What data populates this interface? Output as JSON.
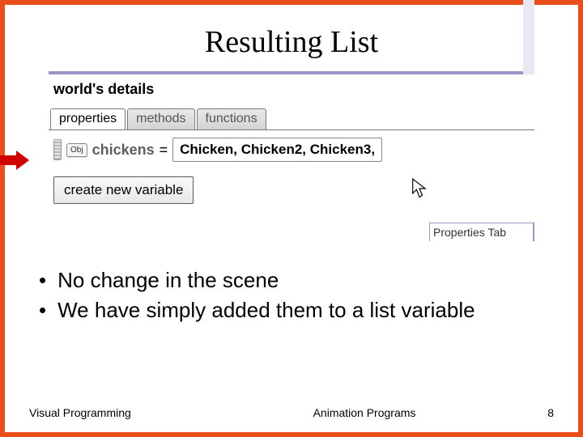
{
  "title": "Resulting List",
  "panel": {
    "heading": "world's details",
    "tabs": [
      {
        "label": "properties",
        "active": true
      },
      {
        "label": "methods",
        "active": false
      },
      {
        "label": "functions",
        "active": false
      }
    ],
    "variable": {
      "type_badge": "Obj",
      "name": "chickens",
      "equals": "=",
      "value_display": "Chicken, Chicken2, Chicken3,"
    },
    "create_button": "create new variable",
    "right_box_title": "Properties Tab"
  },
  "bullets": [
    "No change in the scene",
    "We have simply added them to a list variable"
  ],
  "footer": {
    "left": "Visual Programming",
    "center": "Animation Programs",
    "page": "8"
  }
}
